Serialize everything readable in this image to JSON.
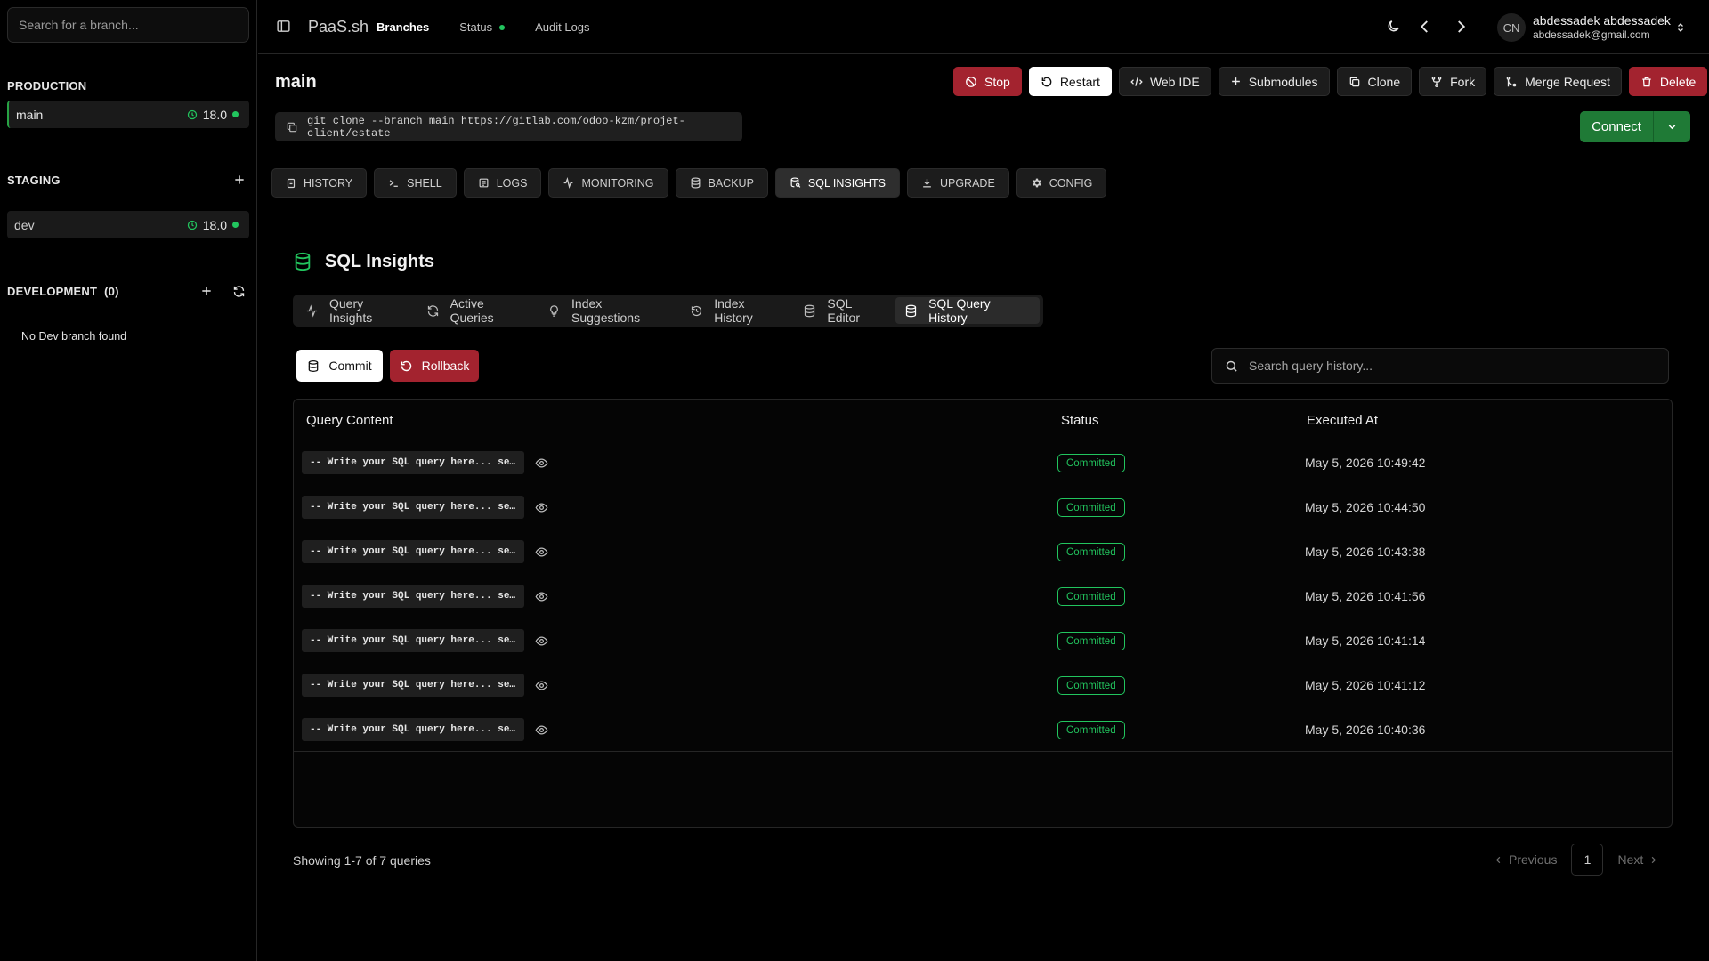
{
  "sidebar": {
    "search_placeholder": "Search for a branch...",
    "production": {
      "title": "PRODUCTION",
      "branches": [
        {
          "name": "main",
          "version": "18.0"
        }
      ]
    },
    "staging": {
      "title": "STAGING",
      "branches": [
        {
          "name": "dev",
          "version": "18.0"
        }
      ]
    },
    "development": {
      "title": "DEVELOPMENT",
      "count": "(0)",
      "empty_text": "No Dev branch found"
    }
  },
  "topbar": {
    "brand": "PaaS.sh",
    "nav": [
      {
        "label": "Branches",
        "active": true
      },
      {
        "label": "Status",
        "active": false
      },
      {
        "label": "Audit Logs",
        "active": false
      }
    ],
    "user": {
      "initials": "CN",
      "name": "abdessadek abdessadek",
      "email": "abdessadek@gmail.com"
    }
  },
  "header": {
    "branch_title": "main",
    "git_clone": "git clone --branch main https://gitlab.com/odoo-kzm/projet-client/estate",
    "actions": {
      "stop": "Stop",
      "restart": "Restart",
      "web_ide": "Web IDE",
      "submodules": "Submodules",
      "clone": "Clone",
      "fork": "Fork",
      "merge_request": "Merge Request",
      "delete": "Delete"
    },
    "connect": "Connect"
  },
  "main_tabs": [
    "HISTORY",
    "SHELL",
    "LOGS",
    "MONITORING",
    "BACKUP",
    "SQL INSIGHTS",
    "UPGRADE",
    "CONFIG"
  ],
  "main_tabs_active": "SQL INSIGHTS",
  "sql": {
    "title": "SQL Insights",
    "tabs": [
      "Query Insights",
      "Active Queries",
      "Index Suggestions",
      "Index History",
      "SQL Editor",
      "SQL Query History"
    ],
    "active_tab": "SQL Query History",
    "commit": "Commit",
    "rollback": "Rollback",
    "search_placeholder": "Search query history...",
    "columns": {
      "query": "Query Content",
      "status": "Status",
      "executed": "Executed At"
    },
    "rows": [
      {
        "query": "-- Write your SQL query here... se…",
        "status": "Committed",
        "executed_at": "May 5, 2026 10:49:42"
      },
      {
        "query": "-- Write your SQL query here... se…",
        "status": "Committed",
        "executed_at": "May 5, 2026 10:44:50"
      },
      {
        "query": "-- Write your SQL query here... se…",
        "status": "Committed",
        "executed_at": "May 5, 2026 10:43:38"
      },
      {
        "query": "-- Write your SQL query here... se…",
        "status": "Committed",
        "executed_at": "May 5, 2026 10:41:56"
      },
      {
        "query": "-- Write your SQL query here... se…",
        "status": "Committed",
        "executed_at": "May 5, 2026 10:41:14"
      },
      {
        "query": "-- Write your SQL query here... se…",
        "status": "Committed",
        "executed_at": "May 5, 2026 10:41:12"
      },
      {
        "query": "-- Write your SQL query here... se…",
        "status": "Committed",
        "executed_at": "May 5, 2026 10:40:36"
      }
    ],
    "footer": "Showing 1-7 of 7 queries",
    "pagination": {
      "previous": "Previous",
      "page": "1",
      "next": "Next"
    }
  },
  "colors": {
    "accent_green": "#22c55e",
    "danger": "#a3232f",
    "connect": "#1f7a36"
  }
}
